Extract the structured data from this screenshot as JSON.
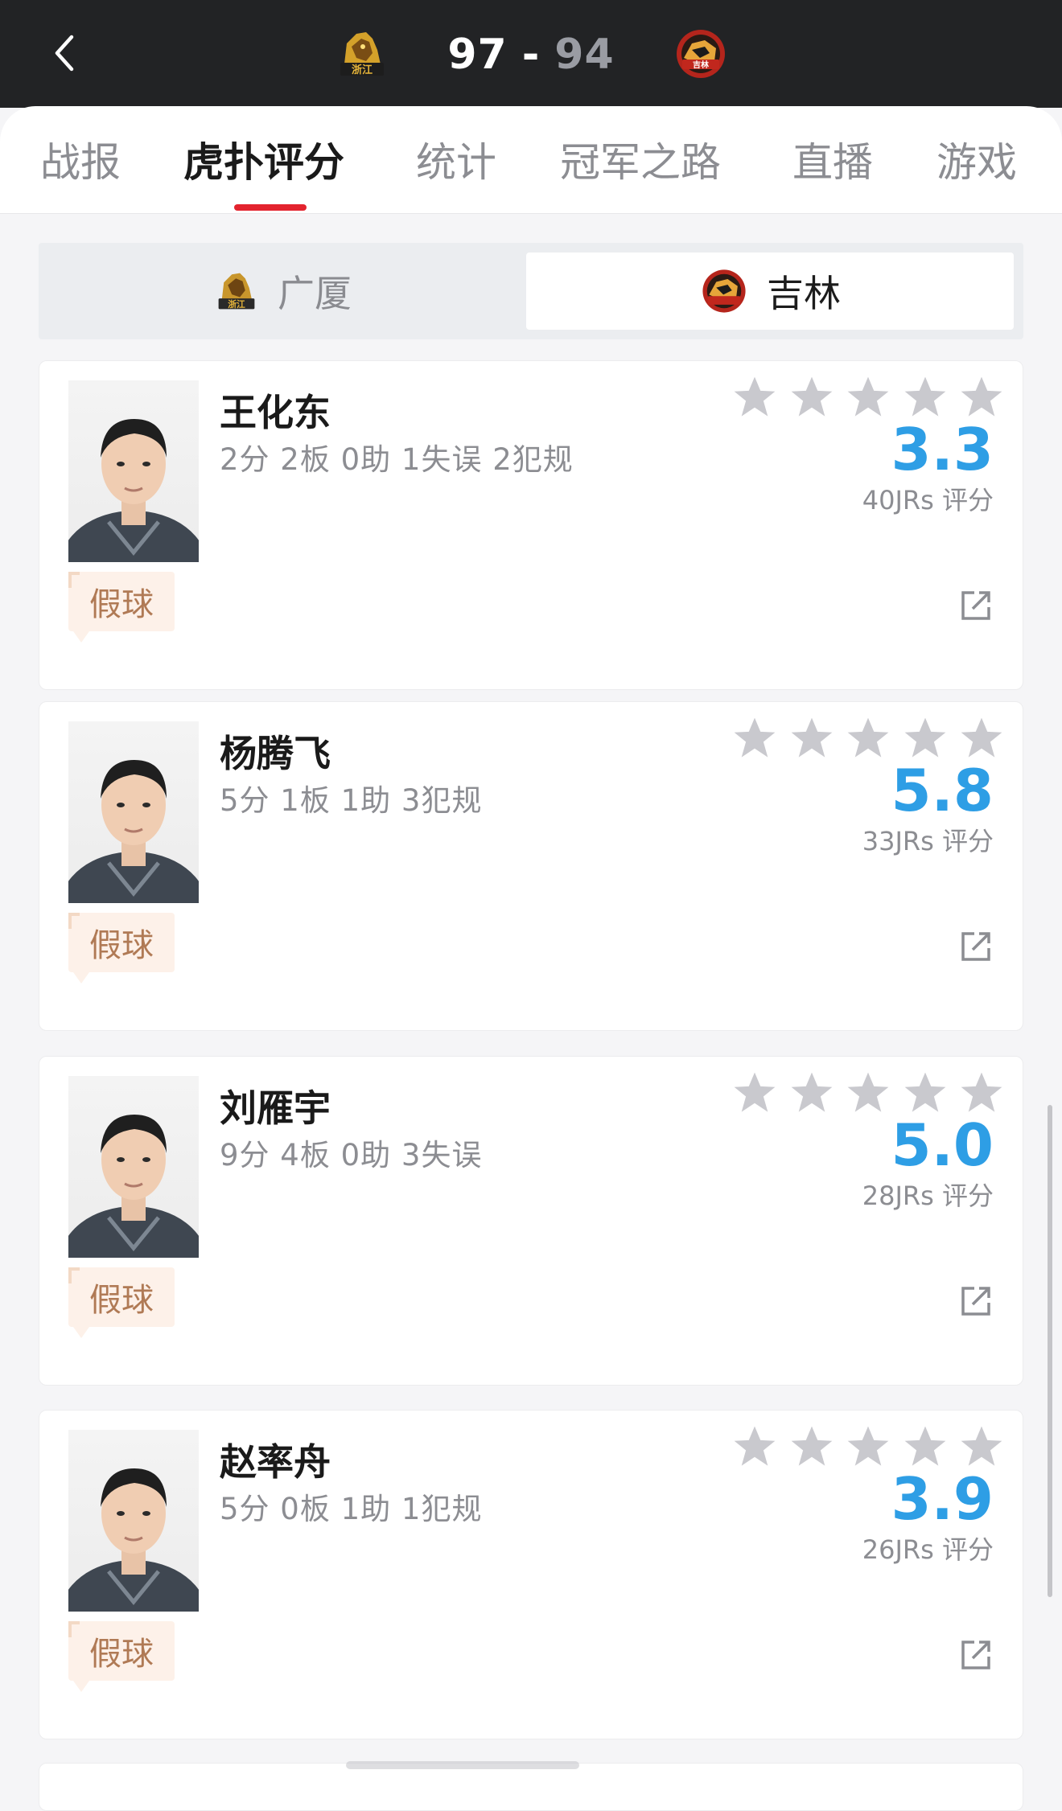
{
  "header": {
    "home_score": "97",
    "separator": "-",
    "away_score": "94",
    "home_logo_icon": "zhejiang-guangsha-lion-logo",
    "away_logo_icon": "jilin-northeast-tigers-logo"
  },
  "tabs": [
    {
      "label": "战报"
    },
    {
      "label": "虎扑评分",
      "active": true
    },
    {
      "label": "统计"
    },
    {
      "label": "冠军之路"
    },
    {
      "label": "直播"
    },
    {
      "label": "游戏"
    }
  ],
  "team_switch": {
    "home_label": "广厦",
    "away_label": "吉林",
    "selected": "吉林"
  },
  "players": [
    {
      "name": "王化东",
      "stats": "2分 2板 0助 1失误 2犯规",
      "rating": "3.3",
      "rating_count": "40JRs 评分",
      "comment": "假球"
    },
    {
      "name": "杨腾飞",
      "stats": "5分 1板 1助 3犯规",
      "rating": "5.8",
      "rating_count": "33JRs 评分",
      "comment": "假球"
    },
    {
      "name": "刘雁宇",
      "stats": "9分 4板 0助 3失误",
      "rating": "5.0",
      "rating_count": "28JRs 评分",
      "comment": "假球"
    },
    {
      "name": "赵率舟",
      "stats": "5分 0板 1助 1犯规",
      "rating": "3.9",
      "rating_count": "26JRs 评分",
      "comment": "假球"
    }
  ],
  "colors": {
    "topbar_bg": "#222325",
    "accent_red": "#e3232e",
    "rating_blue": "#2e9ee5",
    "star_grey": "#c9c9ce",
    "comment_bg": "#fdf1e9",
    "comment_text": "#b07a55"
  }
}
